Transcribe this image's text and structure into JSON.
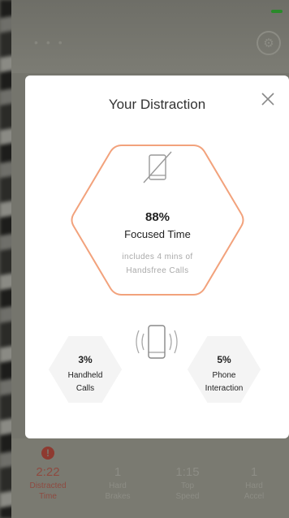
{
  "modal": {
    "title": "Your Distraction",
    "focused": {
      "percent": "88%",
      "label": "Focused Time",
      "note_line1": "includes 4 mins of",
      "note_line2": "Handsfree Calls"
    },
    "handheld": {
      "percent": "3%",
      "label_line1": "Handheld",
      "label_line2": "Calls"
    },
    "interaction": {
      "percent": "5%",
      "label_line1": "Phone",
      "label_line2": "Interaction"
    }
  },
  "background": {
    "stats": [
      {
        "value": "2:22",
        "label_line1": "Distracted",
        "label_line2": "Time"
      },
      {
        "value": "1",
        "label_line1": "Hard",
        "label_line2": "Brakes"
      },
      {
        "value": "1:15",
        "label_line1": "Top",
        "label_line2": "Speed"
      },
      {
        "value": "1",
        "label_line1": "Hard",
        "label_line2": "Accel"
      }
    ]
  },
  "colors": {
    "accent": "#f2a27c",
    "hex_light": "#f3f3f3"
  },
  "icons": {
    "no_phone": "no-phone-icon",
    "vibrating_phone": "vibrating-phone-icon",
    "close": "close-icon"
  }
}
